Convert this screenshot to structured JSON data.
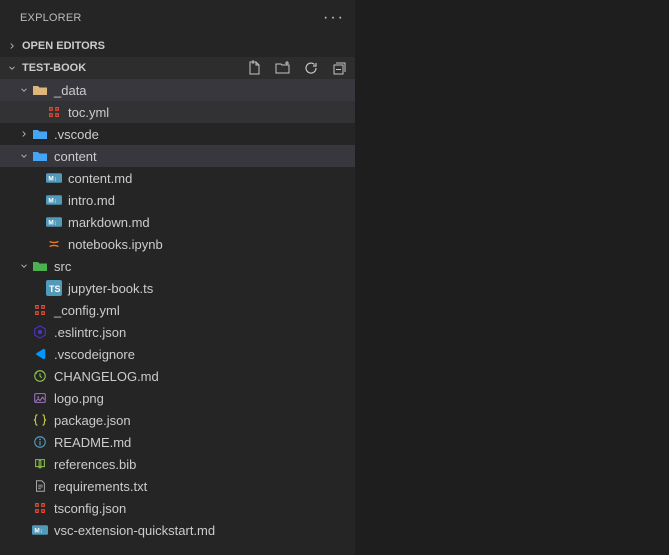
{
  "panel": {
    "title": "Explorer"
  },
  "sections": {
    "openEditors": {
      "label": "Open Editors",
      "expanded": false
    },
    "project": {
      "label": "TEST-BOOK",
      "expanded": true
    }
  },
  "icons": {
    "folder_yellow": "#dcb67a",
    "folder_blue": "#42a5f5",
    "folder_green": "#4caf50",
    "yml": "#e24a33",
    "md": "#519aba",
    "jupyter": "#f37726",
    "ts": "#519aba",
    "json": "#cbcb41",
    "eslint": "#4b32c3",
    "vscode": "#0098ff",
    "changelog": "#8bc34a",
    "image": "#a074c4",
    "info": "#519aba",
    "bib": "#8bc34a",
    "txt": "#aaaaaa"
  },
  "tree": [
    {
      "type": "folder",
      "name": "_data",
      "depth": 0,
      "expanded": true,
      "icon": "folder_yellow",
      "selected": true
    },
    {
      "type": "file",
      "name": "toc.yml",
      "depth": 1,
      "icon": "yml",
      "active": true
    },
    {
      "type": "folder",
      "name": ".vscode",
      "depth": 0,
      "expanded": false,
      "icon": "folder_blue"
    },
    {
      "type": "folder",
      "name": "content",
      "depth": 0,
      "expanded": true,
      "icon": "folder_blue",
      "selected": true
    },
    {
      "type": "file",
      "name": "content.md",
      "depth": 1,
      "icon": "md"
    },
    {
      "type": "file",
      "name": "intro.md",
      "depth": 1,
      "icon": "md"
    },
    {
      "type": "file",
      "name": "markdown.md",
      "depth": 1,
      "icon": "md"
    },
    {
      "type": "file",
      "name": "notebooks.ipynb",
      "depth": 1,
      "icon": "jupyter"
    },
    {
      "type": "folder",
      "name": "src",
      "depth": 0,
      "expanded": true,
      "icon": "folder_green"
    },
    {
      "type": "file",
      "name": "jupyter-book.ts",
      "depth": 1,
      "icon": "ts"
    },
    {
      "type": "file",
      "name": "_config.yml",
      "depth": 0,
      "icon": "yml"
    },
    {
      "type": "file",
      "name": ".eslintrc.json",
      "depth": 0,
      "icon": "eslint"
    },
    {
      "type": "file",
      "name": ".vscodeignore",
      "depth": 0,
      "icon": "vscode"
    },
    {
      "type": "file",
      "name": "CHANGELOG.md",
      "depth": 0,
      "icon": "changelog"
    },
    {
      "type": "file",
      "name": "logo.png",
      "depth": 0,
      "icon": "image"
    },
    {
      "type": "file",
      "name": "package.json",
      "depth": 0,
      "icon": "json"
    },
    {
      "type": "file",
      "name": "README.md",
      "depth": 0,
      "icon": "info"
    },
    {
      "type": "file",
      "name": "references.bib",
      "depth": 0,
      "icon": "bib"
    },
    {
      "type": "file",
      "name": "requirements.txt",
      "depth": 0,
      "icon": "txt"
    },
    {
      "type": "file",
      "name": "tsconfig.json",
      "depth": 0,
      "icon": "yml"
    },
    {
      "type": "file",
      "name": "vsc-extension-quickstart.md",
      "depth": 0,
      "icon": "md"
    }
  ]
}
